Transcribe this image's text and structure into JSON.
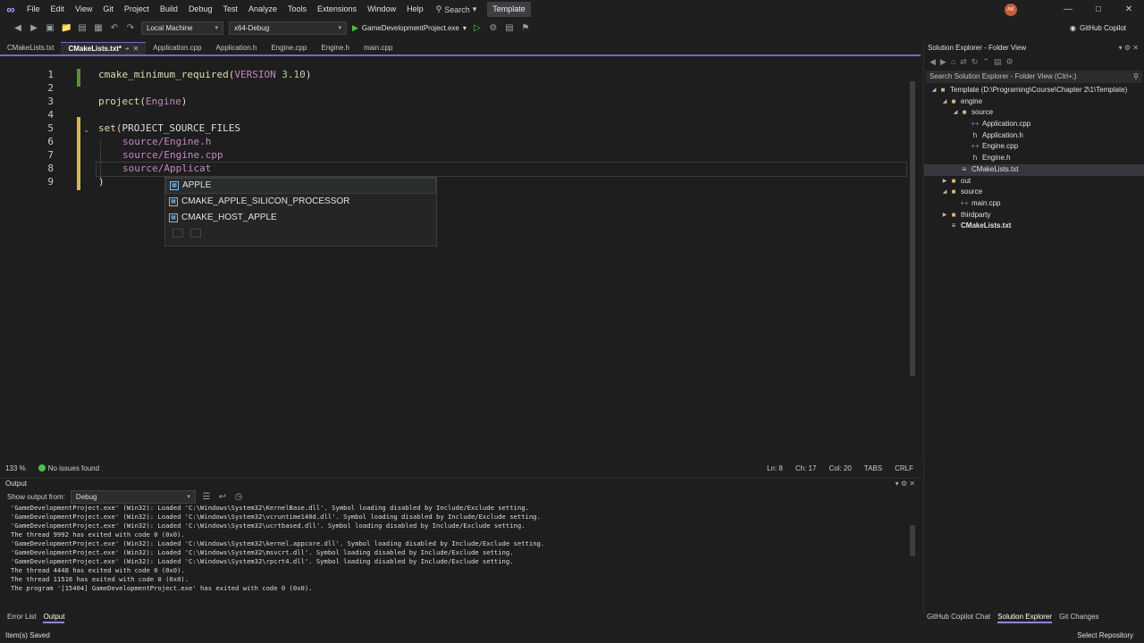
{
  "menubar": {
    "items": [
      "File",
      "Edit",
      "View",
      "Git",
      "Project",
      "Build",
      "Debug",
      "Test",
      "Analyze",
      "Tools",
      "Extensions",
      "Window",
      "Help"
    ],
    "search_label": "Search",
    "solution_name": "Template",
    "avatar_initials": "AK"
  },
  "toolbar": {
    "target": "Local Machine",
    "config": "x64-Debug",
    "run_target": "GameDevelopmentProject.exe",
    "copilot": "GitHub Copilot"
  },
  "tabs": [
    {
      "label": "CMakeLists.txt",
      "active": false
    },
    {
      "label": "CMakeLists.txt*",
      "active": true
    },
    {
      "label": "Application.cpp",
      "active": false
    },
    {
      "label": "Application.h",
      "active": false
    },
    {
      "label": "Engine.cpp",
      "active": false
    },
    {
      "label": "Engine.h",
      "active": false
    },
    {
      "label": "main.cpp",
      "active": false
    }
  ],
  "editor": {
    "line_numbers": [
      "1",
      "2",
      "3",
      "4",
      "5",
      "6",
      "7",
      "8",
      "9"
    ],
    "lines": {
      "l1_fn": "cmake_minimum_required(",
      "l1_kw": "VERSION",
      "l1_num": " 3.10",
      "l1_end": ")",
      "l3_fn": "project(",
      "l3_arg": "Engine",
      "l3_end": ")",
      "l5_fn": "set(",
      "l5_arg": "PROJECT_SOURCE_FILES",
      "l6": "source/Engine.h",
      "l7": "source/Engine.cpp",
      "l8": "source/Applicat",
      "l9": ")"
    },
    "completion": [
      "APPLE",
      "CMAKE_APPLE_SILICON_PROCESSOR",
      "CMAKE_HOST_APPLE"
    ]
  },
  "editor_status": {
    "zoom": "133 %",
    "issues": "No issues found",
    "line": "Ln: 8",
    "col": "Ch: 17",
    "colnum": "Col: 20",
    "tabs": "TABS",
    "eol": "CRLF"
  },
  "output": {
    "title": "Output",
    "show_label": "Show output from:",
    "source": "Debug",
    "lines": [
      "'GameDevelopmentProject.exe' (Win32): Loaded 'C:\\Windows\\System32\\KernelBase.dll'. Symbol loading disabled by Include/Exclude setting.",
      "'GameDevelopmentProject.exe' (Win32): Loaded 'C:\\Windows\\System32\\vcruntime140d.dll'. Symbol loading disabled by Include/Exclude setting.",
      "'GameDevelopmentProject.exe' (Win32): Loaded 'C:\\Windows\\System32\\ucrtbased.dll'. Symbol loading disabled by Include/Exclude setting.",
      "The thread 9992 has exited with code 0 (0x0).",
      "'GameDevelopmentProject.exe' (Win32): Loaded 'C:\\Windows\\System32\\kernel.appcore.dll'. Symbol loading disabled by Include/Exclude setting.",
      "'GameDevelopmentProject.exe' (Win32): Loaded 'C:\\Windows\\System32\\msvcrt.dll'. Symbol loading disabled by Include/Exclude setting.",
      "'GameDevelopmentProject.exe' (Win32): Loaded 'C:\\Windows\\System32\\rpcrt4.dll'. Symbol loading disabled by Include/Exclude setting.",
      "The thread 4448 has exited with code 0 (0x0).",
      "The thread 11516 has exited with code 0 (0x0).",
      "The program '[15404] GameDevelopmentProject.exe' has exited with code 0 (0x0)."
    ]
  },
  "bottom_tabs": [
    "Error List",
    "Output"
  ],
  "solution_explorer": {
    "title": "Solution Explorer - Folder View",
    "search_placeholder": "Search Solution Explorer - Folder View (Ctrl+;)",
    "tree": [
      {
        "label": "Template (D:\\Programing\\Course\\Chapter 2\\1\\Template)",
        "kind": "folder",
        "depth": 0,
        "arrow": "down"
      },
      {
        "label": "engine",
        "kind": "folder",
        "depth": 1,
        "arrow": "down"
      },
      {
        "label": "source",
        "kind": "folder",
        "depth": 2,
        "arrow": "down"
      },
      {
        "label": "Application.cpp",
        "kind": "cpp",
        "depth": 3,
        "arrow": ""
      },
      {
        "label": "Application.h",
        "kind": "h",
        "depth": 3,
        "arrow": ""
      },
      {
        "label": "Engine.cpp",
        "kind": "cpp",
        "depth": 3,
        "arrow": ""
      },
      {
        "label": "Engine.h",
        "kind": "h",
        "depth": 3,
        "arrow": ""
      },
      {
        "label": "CMakeLists.txt",
        "kind": "txt",
        "depth": 2,
        "arrow": "",
        "selected": true
      },
      {
        "label": "out",
        "kind": "folder",
        "depth": 1,
        "arrow": "right"
      },
      {
        "label": "source",
        "kind": "folder",
        "depth": 1,
        "arrow": "down"
      },
      {
        "label": "main.cpp",
        "kind": "cpp",
        "depth": 2,
        "arrow": ""
      },
      {
        "label": "thirdparty",
        "kind": "folder",
        "depth": 1,
        "arrow": "right"
      },
      {
        "label": "CMakeLists.txt",
        "kind": "txt",
        "depth": 1,
        "arrow": "",
        "bold": true
      }
    ],
    "bottom_tabs": [
      "GitHub Copilot Chat",
      "Solution Explorer",
      "Git Changes"
    ]
  },
  "statusbar": {
    "left": "Item(s) Saved",
    "right": "Select Repository"
  }
}
